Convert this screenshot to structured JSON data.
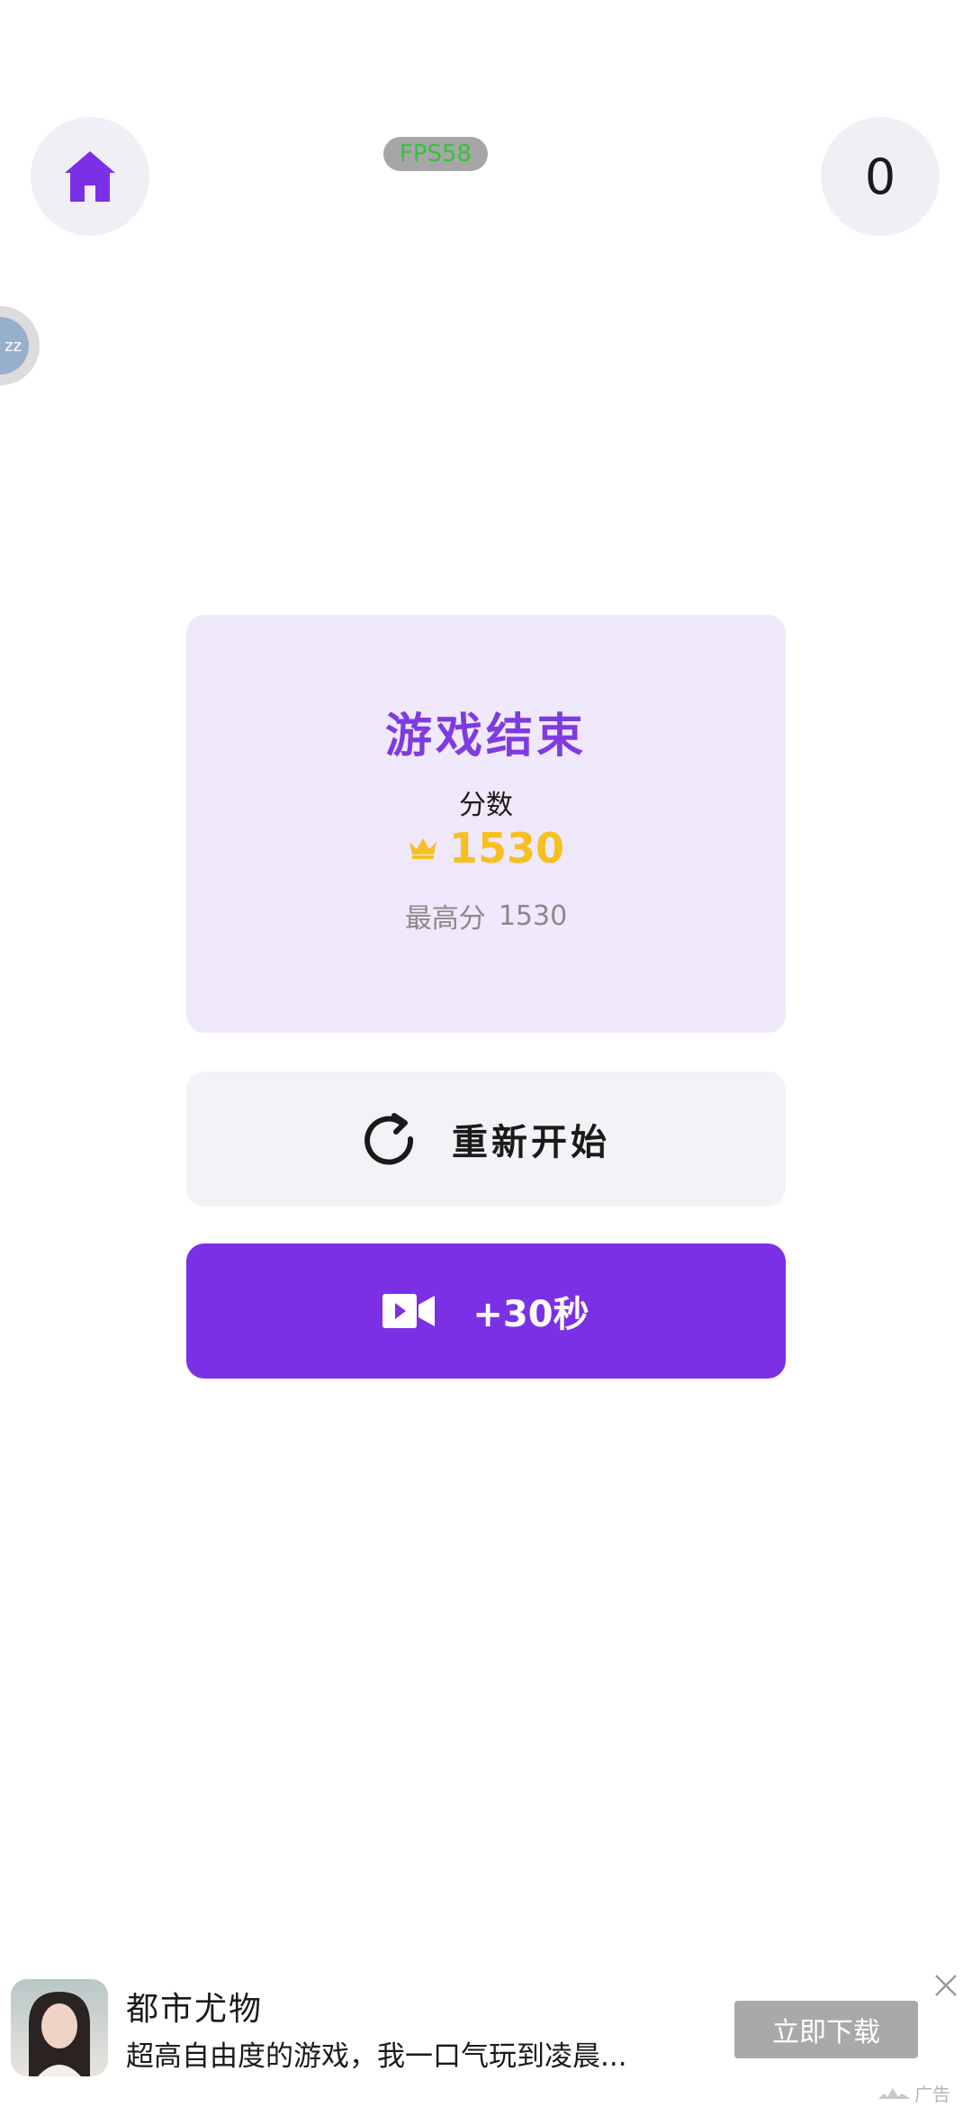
{
  "header": {
    "score": "0",
    "fps_label": "FPS58",
    "side_bubble_text": "zz"
  },
  "game_over": {
    "title": "游戏结束",
    "score_label": "分数",
    "score_value": "1530",
    "best_label": "最高分",
    "best_value": "1530"
  },
  "actions": {
    "restart_label": "重新开始",
    "bonus_label": "+30秒"
  },
  "ad": {
    "title": "都市尤物",
    "description": "超高自由度的游戏，我一口气玩到凌晨...",
    "cta_label": "立即下载",
    "tag": "广告"
  },
  "colors": {
    "accent": "#7c30e6",
    "title_purple": "#7e3be0",
    "score_gold": "#f6c022",
    "card_bg": "#f0e8fb"
  },
  "icons": {
    "home": "home-icon",
    "crown": "crown-icon",
    "restart": "refresh-icon",
    "video": "video-camera-icon",
    "close": "close-icon"
  }
}
